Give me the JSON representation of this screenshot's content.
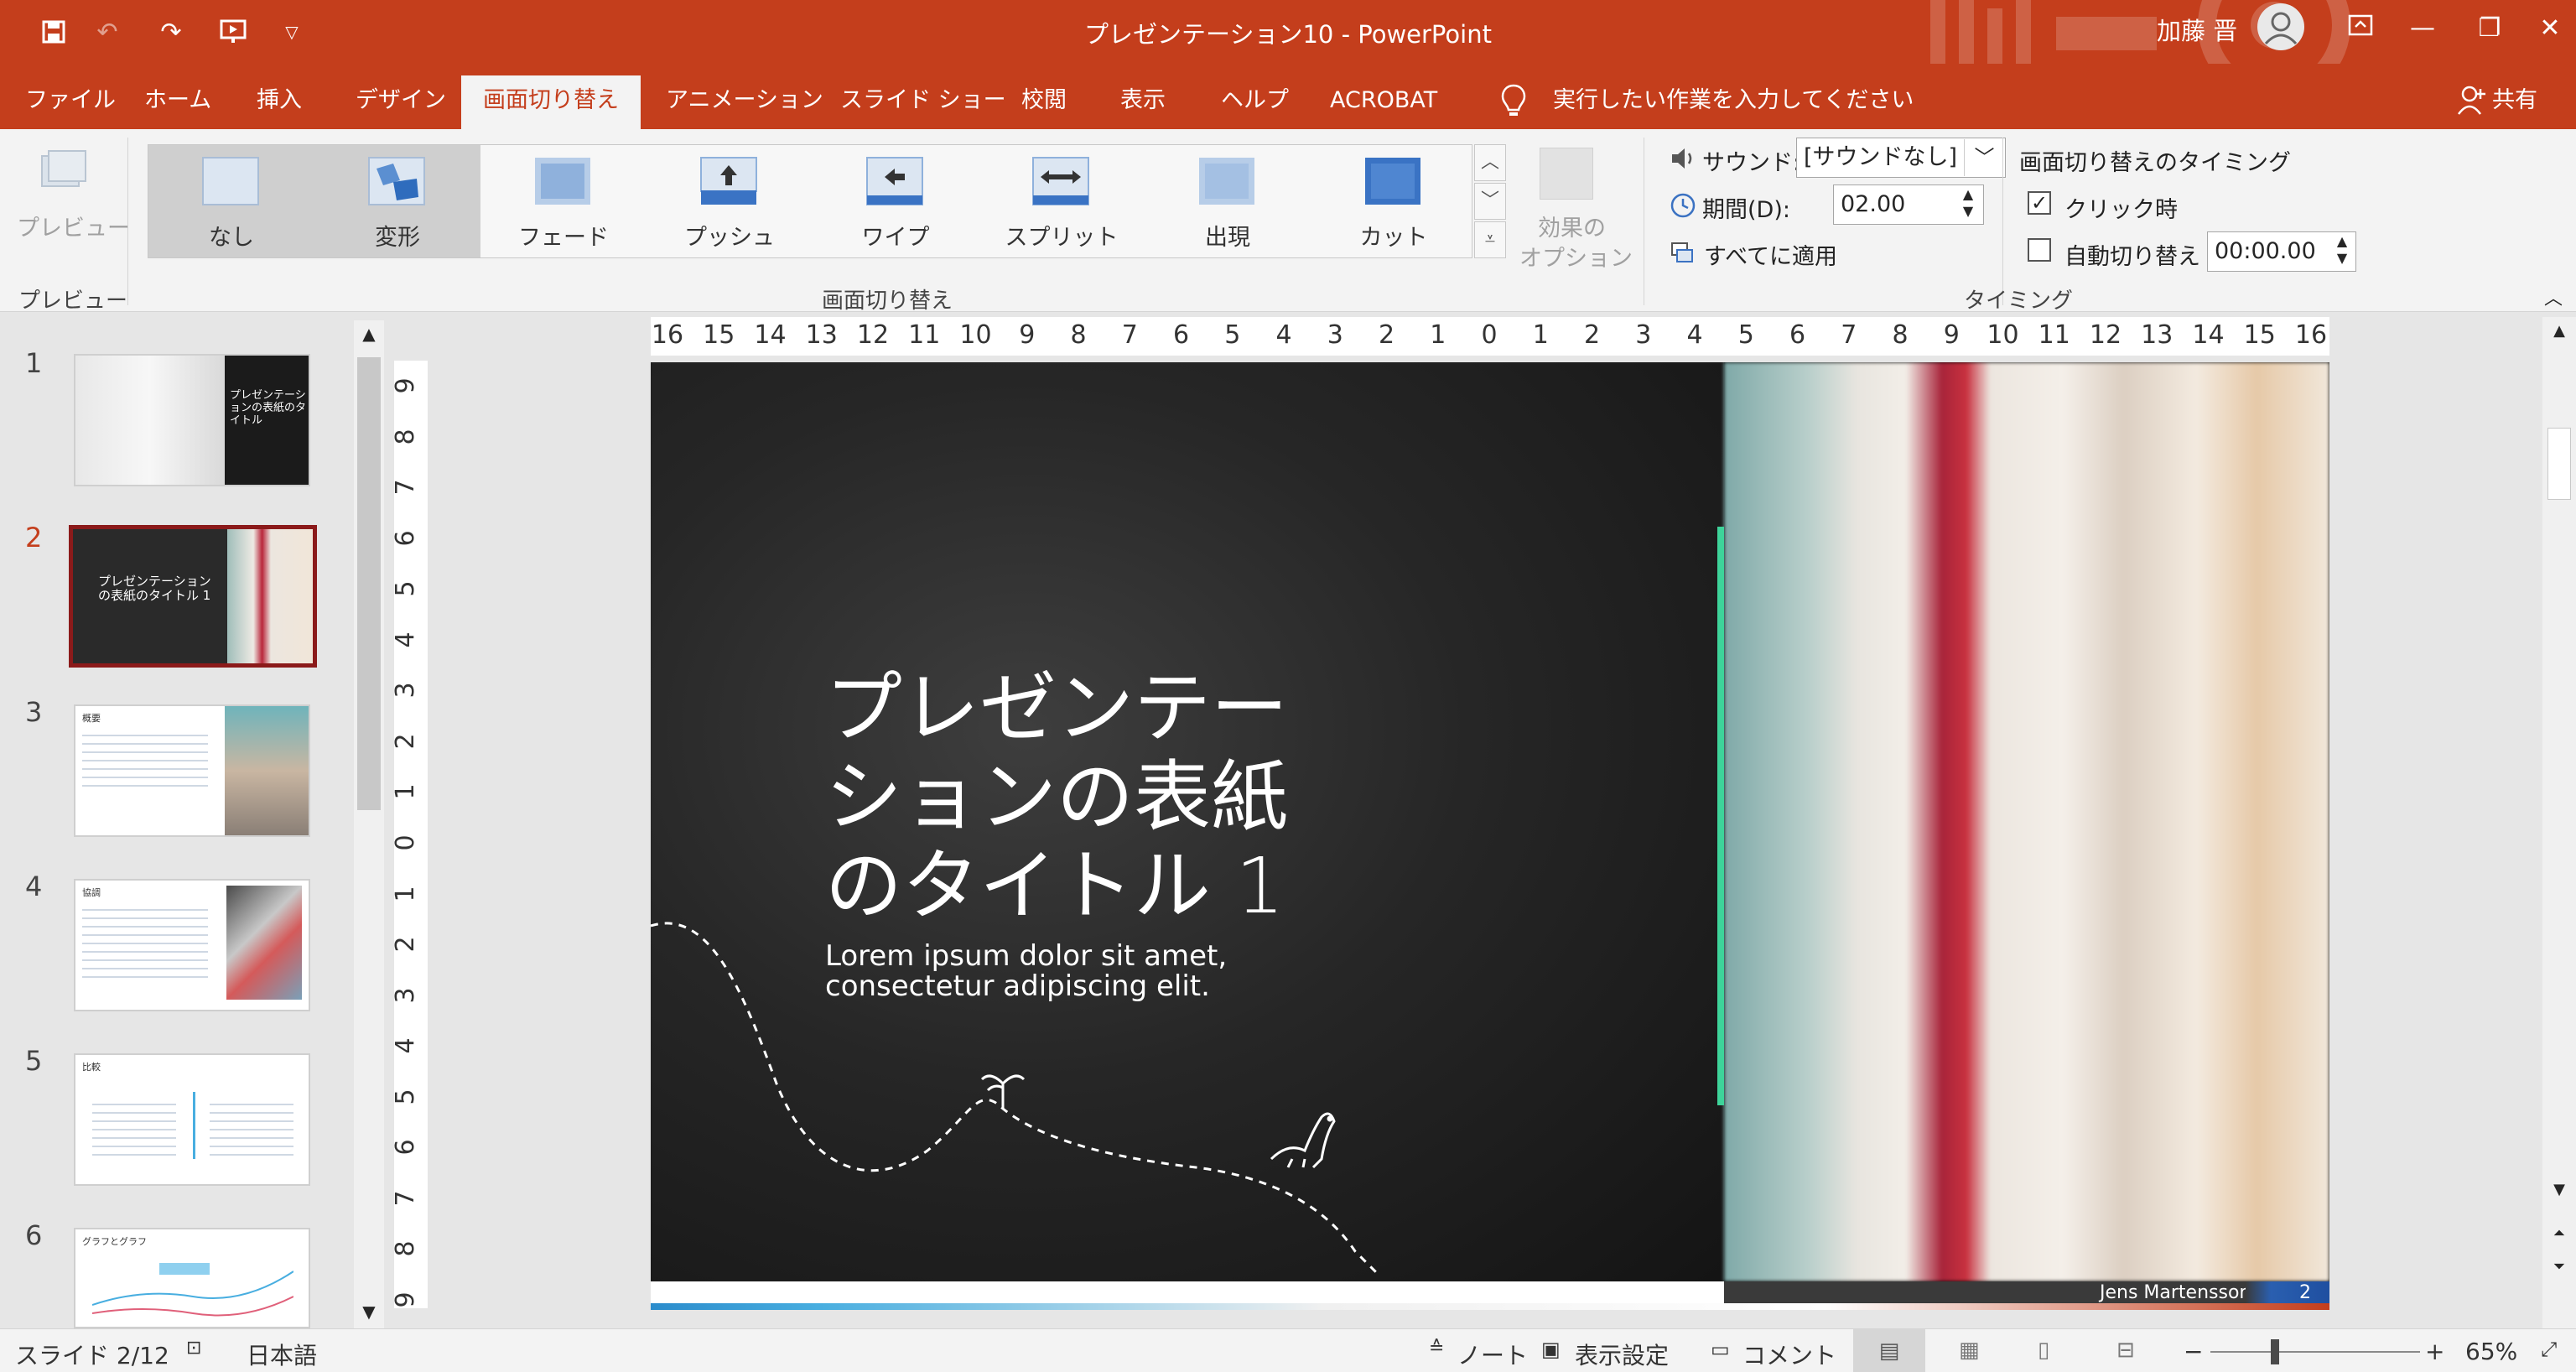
{
  "window": {
    "title": "プレゼンテーション10 - PowerPoint",
    "user": "加藤 晋"
  },
  "tabs": [
    {
      "label": "ファイル"
    },
    {
      "label": "ホーム"
    },
    {
      "label": "挿入"
    },
    {
      "label": "デザイン"
    },
    {
      "label": "画面切り替え"
    },
    {
      "label": "アニメーション"
    },
    {
      "label": "スライド ショー"
    },
    {
      "label": "校閲"
    },
    {
      "label": "表示"
    },
    {
      "label": "ヘルプ"
    },
    {
      "label": "ACROBAT"
    }
  ],
  "tell_me": "実行したい作業を入力してください",
  "share": "共有",
  "ribbon": {
    "preview_button": "プレビュー",
    "preview_group": "プレビュー",
    "transitions": [
      {
        "label": "なし"
      },
      {
        "label": "変形"
      },
      {
        "label": "フェード"
      },
      {
        "label": "プッシュ"
      },
      {
        "label": "ワイプ"
      },
      {
        "label": "スプリット"
      },
      {
        "label": "出現"
      },
      {
        "label": "カット"
      }
    ],
    "transitions_group": "画面切り替え",
    "effect_options_line1": "効果の",
    "effect_options_line2": "オプション",
    "sound_label": "サウンド:",
    "sound_value": "[サウンドなし]",
    "duration_label": "期間(D):",
    "duration_value": "02.00",
    "apply_all": "すべてに適用",
    "timing_header": "画面切り替えのタイミング",
    "on_click": "クリック時",
    "on_click_checked": true,
    "auto_advance": "自動切り替え",
    "auto_advance_checked": false,
    "auto_advance_value": "00:00.00",
    "timing_group": "タイミング"
  },
  "ruler": {
    "h": [
      "16",
      "15",
      "14",
      "13",
      "12",
      "11",
      "10",
      "9",
      "8",
      "7",
      "6",
      "5",
      "4",
      "3",
      "2",
      "1",
      "0",
      "1",
      "2",
      "3",
      "4",
      "5",
      "6",
      "7",
      "8",
      "9",
      "10",
      "11",
      "12",
      "13",
      "14",
      "15",
      "16"
    ],
    "v": [
      "9",
      "8",
      "7",
      "6",
      "5",
      "4",
      "3",
      "2",
      "1",
      "0",
      "1",
      "2",
      "3",
      "4",
      "5",
      "6",
      "7",
      "8",
      "9"
    ]
  },
  "thumbnails": [
    {
      "num": "1",
      "title": "プレゼンテーションの表紙のタイトル"
    },
    {
      "num": "2",
      "title": "プレゼンテーションの表紙のタイトル 1",
      "selected": true
    },
    {
      "num": "3",
      "title": "概要"
    },
    {
      "num": "4",
      "title": "協調"
    },
    {
      "num": "5",
      "title": "比較"
    },
    {
      "num": "6",
      "title": "グラフとグラフ"
    }
  ],
  "slide": {
    "title": "プレゼンテーションの表紙のタイトル 1",
    "subtitle": "Lorem ipsum dolor sit amet, consectetur adipiscing elit.",
    "credit": "Jens Martensson",
    "page": "2"
  },
  "status": {
    "slide": "スライド 2/12",
    "language": "日本語",
    "notes": "ノート",
    "display": "表示設定",
    "comments": "コメント",
    "zoom": "65%",
    "zoom_minus": "−",
    "zoom_plus": "+"
  },
  "colors": {
    "accent": "#c43e1c",
    "selected_border": "#8b1a1a"
  }
}
